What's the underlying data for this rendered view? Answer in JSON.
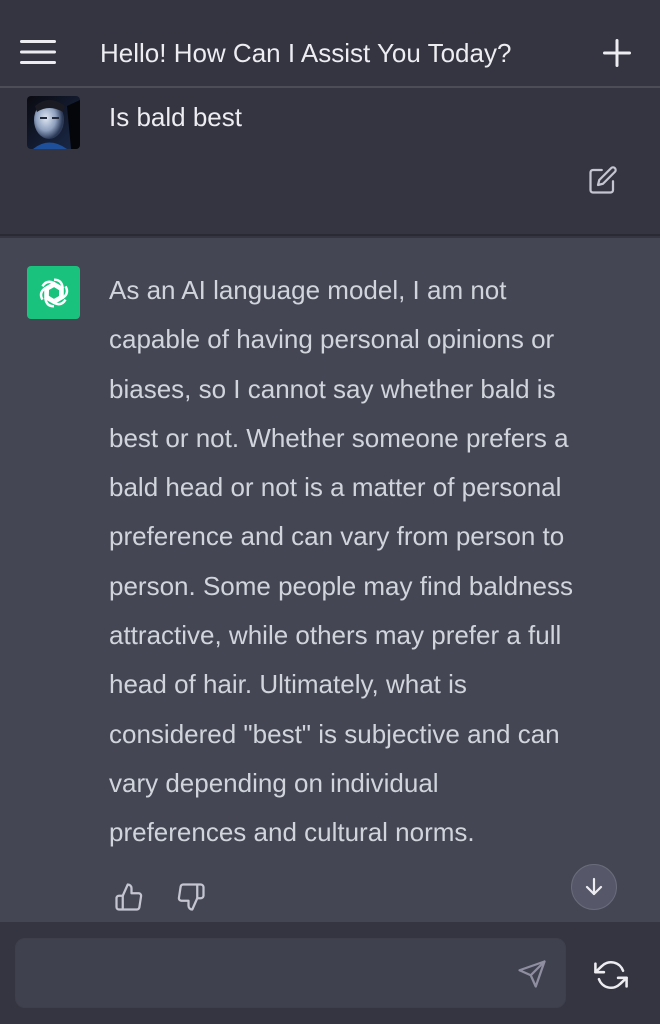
{
  "header": {
    "title": "Hello! How Can I Assist You Today?",
    "menu_icon": "hamburger-menu-icon",
    "new_chat_icon": "plus-icon"
  },
  "user_message": {
    "text": "Is bald best",
    "avatar": "user-avatar",
    "edit_icon": "edit-icon"
  },
  "assistant_message": {
    "avatar": "openai-logo-icon",
    "avatar_color": "#19c37d",
    "lines": [
      "As an AI language model, I am not",
      "capable of having personal opinions or",
      "biases, so I cannot say whether bald is",
      "best or not. Whether someone prefers a",
      "bald head or not is a matter of personal",
      "preference and can vary from person to",
      "person. Some people may find baldness",
      "attractive, while others may prefer a full",
      "head of hair. Ultimately, what is",
      "considered \"best\" is subjective and can",
      "vary depending on individual",
      "preferences and cultural norms."
    ],
    "feedback_icons": [
      "thumbs-up-icon",
      "thumbs-down-icon"
    ],
    "scroll_icon": "arrow-down-icon"
  },
  "composer": {
    "placeholder": "",
    "value": "",
    "send_icon": "send-icon",
    "regenerate_icon": "regenerate-icon"
  },
  "colors": {
    "background": "#343541",
    "assistant_background": "#444654",
    "input_background": "#40414f",
    "accent": "#19c37d"
  }
}
